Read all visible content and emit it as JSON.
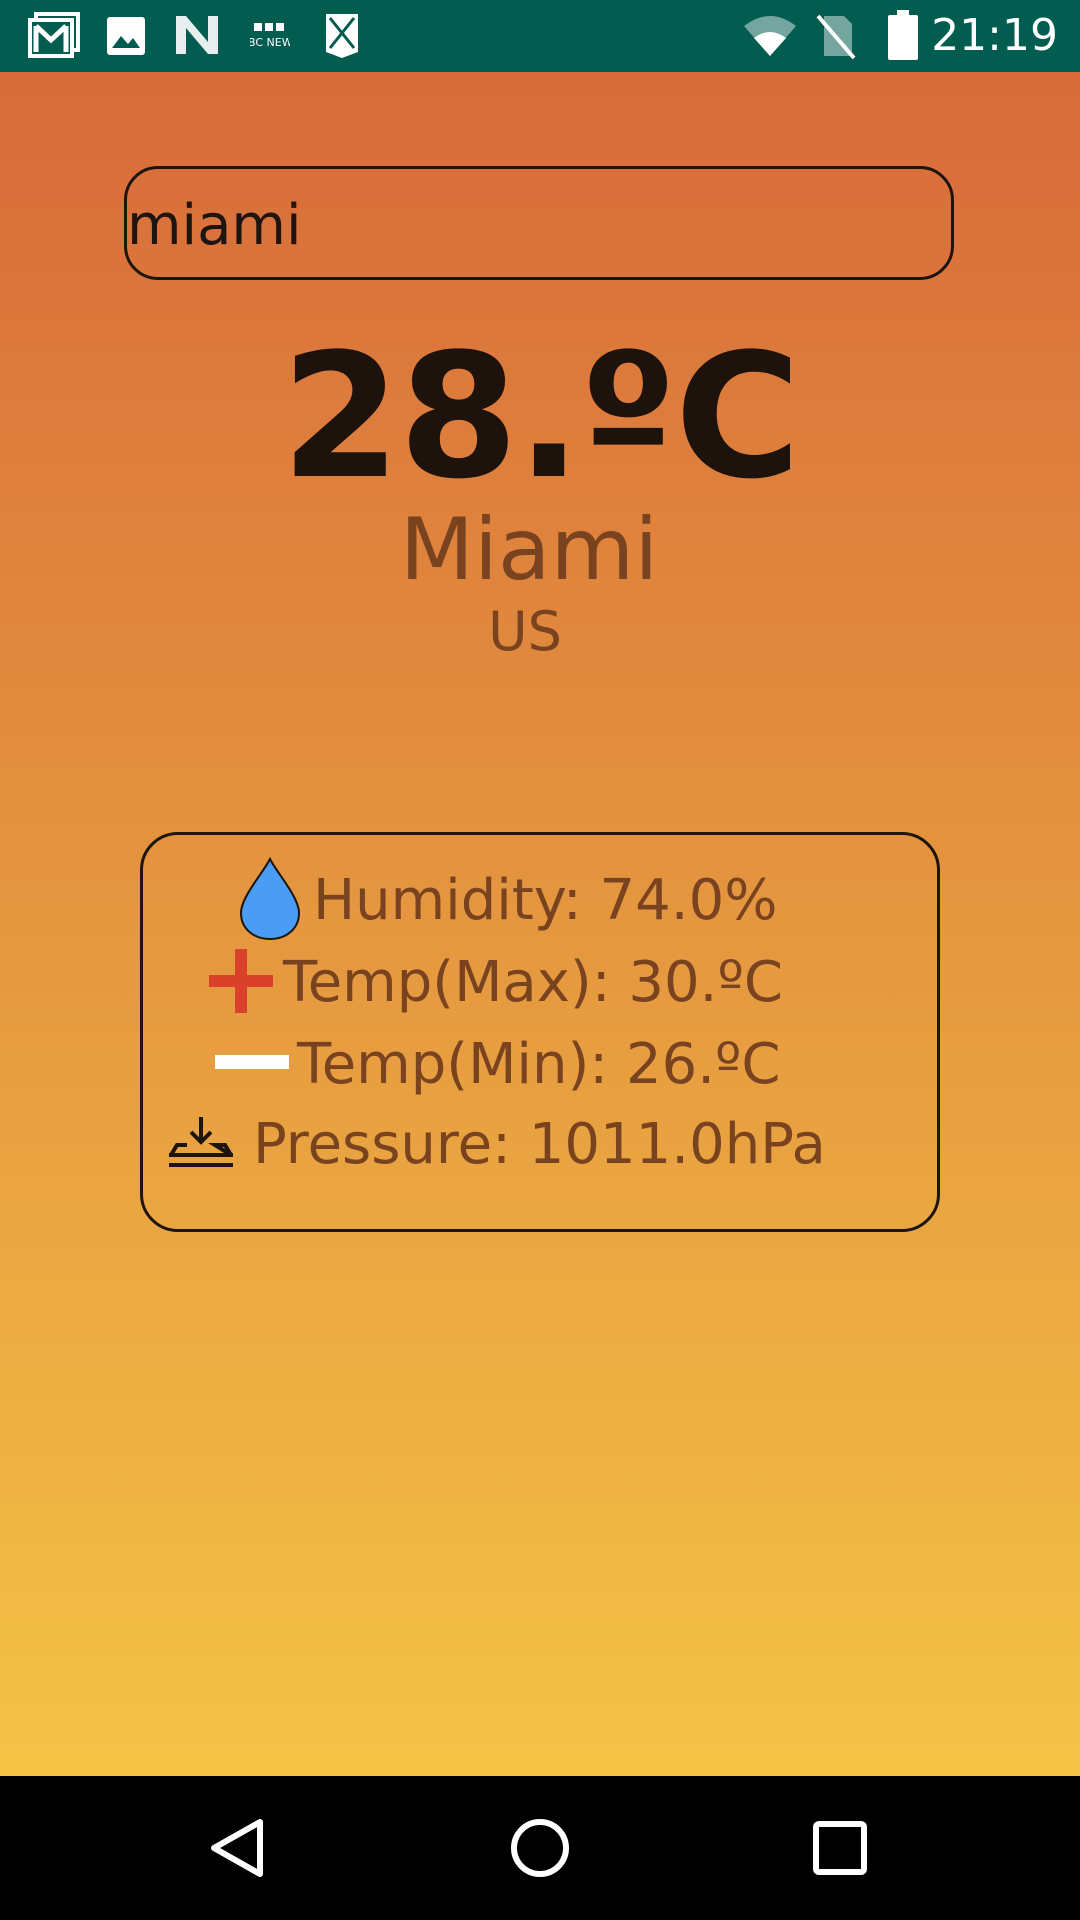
{
  "status_bar": {
    "time": "21:19",
    "notification_icons": [
      "gmail-icon",
      "gallery-icon",
      "news-n-icon",
      "bbc-news-icon",
      "bookmark-app-icon"
    ],
    "bbc_label": "BBC NEWS",
    "system_icons": [
      "wifi-icon",
      "no-sim-icon",
      "battery-icon"
    ],
    "background_color": "#025c50"
  },
  "search": {
    "value": "miami"
  },
  "weather": {
    "temperature": "28.ºC",
    "city": "Miami",
    "country": "US"
  },
  "details": {
    "humidity": "Humidity: 74.0%",
    "temp_max": "Temp(Max): 30.ºC",
    "temp_min": "Temp(Min): 26.ºC",
    "pressure": "Pressure: 1011.0hPa",
    "icons": {
      "humidity": "water-drop-icon",
      "temp_max": "plus-icon",
      "temp_min": "minus-icon",
      "pressure": "pressure-icon"
    }
  },
  "colors": {
    "gradient_top": "#d86a3a",
    "gradient_bottom": "#f4c345",
    "text_primary": "#1e120c",
    "text_secondary": "#7a4320",
    "plus_icon": "#d9412a",
    "drop_icon": "#4a9cf5"
  },
  "nav_bar": {
    "buttons": [
      "back-icon",
      "home-icon",
      "recents-icon"
    ]
  }
}
